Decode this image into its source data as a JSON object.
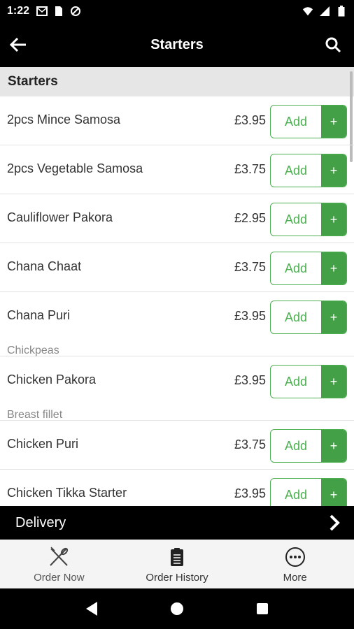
{
  "status_bar": {
    "time": "1:22",
    "icons_left": [
      "mail-icon",
      "sim-icon",
      "sync-icon"
    ],
    "icons_right": [
      "wifi-icon",
      "signal-icon",
      "battery-icon"
    ]
  },
  "app_bar": {
    "title": "Starters",
    "back_icon": "arrow-back-icon",
    "search_icon": "search-icon"
  },
  "section": {
    "title": "Starters"
  },
  "items": [
    {
      "name": "2pcs Mince Samosa",
      "price": "£3.95",
      "desc": "",
      "add_label": "Add",
      "plus_label": "+"
    },
    {
      "name": "2pcs Vegetable Samosa",
      "price": "£3.75",
      "desc": "",
      "add_label": "Add",
      "plus_label": "+"
    },
    {
      "name": "Cauliflower Pakora",
      "price": "£2.95",
      "desc": "",
      "add_label": "Add",
      "plus_label": "+"
    },
    {
      "name": "Chana Chaat",
      "price": "£3.75",
      "desc": "",
      "add_label": "Add",
      "plus_label": "+"
    },
    {
      "name": "Chana Puri",
      "price": "£3.95",
      "desc": "Chickpeas",
      "add_label": "Add",
      "plus_label": "+"
    },
    {
      "name": "Chicken Pakora",
      "price": "£3.95",
      "desc": "Breast fillet",
      "add_label": "Add",
      "plus_label": "+"
    },
    {
      "name": "Chicken Puri",
      "price": "£3.75",
      "desc": "",
      "add_label": "Add",
      "plus_label": "+"
    },
    {
      "name": "Chicken Tikka Starter",
      "price": "£3.95",
      "desc": "",
      "add_label": "Add",
      "plus_label": "+"
    }
  ],
  "delivery_bar": {
    "label": "Delivery",
    "chevron_icon": "chevron-right-icon"
  },
  "bottom_nav": [
    {
      "label": "Order Now",
      "icon": "fork-knife-icon"
    },
    {
      "label": "Order History",
      "icon": "clipboard-icon"
    },
    {
      "label": "More",
      "icon": "more-icon"
    }
  ],
  "colors": {
    "accent": "#43a047",
    "bar": "#000000",
    "section_bg": "#e6e6e6"
  }
}
